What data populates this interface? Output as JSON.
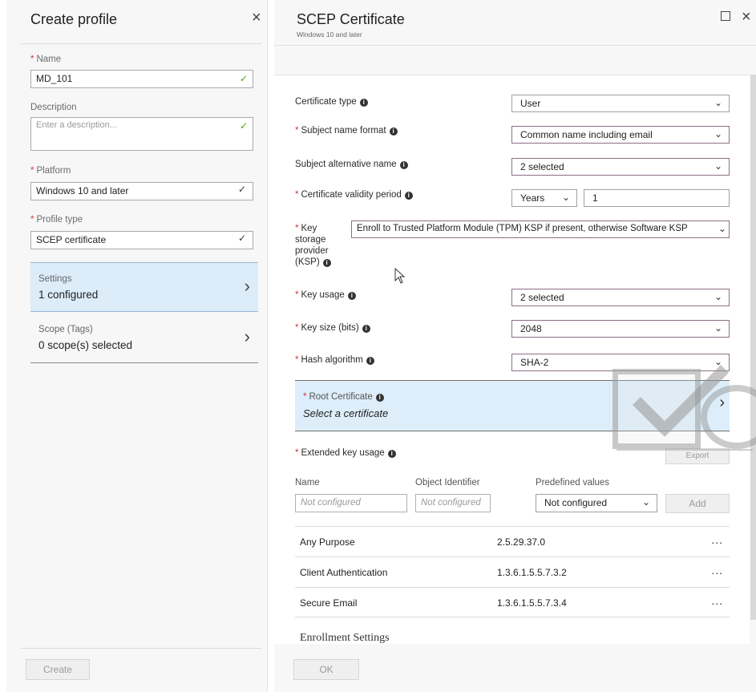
{
  "left_blade": {
    "title": "Create profile",
    "close_glyph": "×",
    "name_label": "Name",
    "name_value": "MD_101",
    "description_label": "Description",
    "description_placeholder": "Enter a description...",
    "platform_label": "Platform",
    "platform_value": "Windows 10 and later",
    "profile_type_label": "Profile type",
    "profile_type_value": "SCEP certificate",
    "nav": [
      {
        "title": "Settings",
        "value": "1 configured"
      },
      {
        "title": "Scope (Tags)",
        "value": "0 scope(s) selected"
      }
    ],
    "create_label": "Create"
  },
  "right_blade": {
    "title": "SCEP Certificate",
    "subtitle": "Windows 10 and later",
    "close_glyph": "×",
    "fields": {
      "certificate_type": {
        "label": "Certificate type",
        "value": "User"
      },
      "subject_name_format": {
        "label": "Subject name format",
        "value": "Common name including email"
      },
      "subject_alternative_name": {
        "label": "Subject alternative name",
        "value": "2 selected"
      },
      "validity_period": {
        "label": "Certificate validity period",
        "unit": "Years",
        "value": "1"
      },
      "ksp": {
        "label_lines": [
          "Key",
          "storage",
          "provider",
          "(KSP)"
        ],
        "value": "Enroll to Trusted Platform Module (TPM) KSP if present, otherwise Software KSP"
      },
      "key_usage": {
        "label": "Key usage",
        "value": "2 selected"
      },
      "key_size": {
        "label": "Key size (bits)",
        "value": "2048"
      },
      "hash_algorithm": {
        "label": "Hash algorithm",
        "value": "SHA-2"
      }
    },
    "root_certificate": {
      "label": "Root Certificate",
      "value": "Select a certificate"
    },
    "extended_key_usage": {
      "label": "Extended key usage",
      "export_label": "Export",
      "columns": [
        "Name",
        "Object Identifier",
        "Predefined values"
      ],
      "name_placeholder": "Not configured",
      "oid_placeholder": "Not configured",
      "predefined_value": "Not configured",
      "add_label": "Add",
      "rows": [
        {
          "name": "Any Purpose",
          "oid": "2.5.29.37.0"
        },
        {
          "name": "Client Authentication",
          "oid": "1.3.6.1.5.5.7.3.2"
        },
        {
          "name": "Secure Email",
          "oid": "1.3.6.1.5.5.7.3.4"
        }
      ],
      "more_glyph": "..."
    },
    "enrollment_settings_label": "Enrollment Settings",
    "ok_label": "OK"
  },
  "icons": {
    "check": "check-icon",
    "chevron": "chevron-down-icon",
    "info": "info-icon",
    "arrow": "chevron-right-icon"
  },
  "colors": {
    "required": "#d13438",
    "check": "#57a300",
    "selected_nav": "#dcecf9"
  }
}
